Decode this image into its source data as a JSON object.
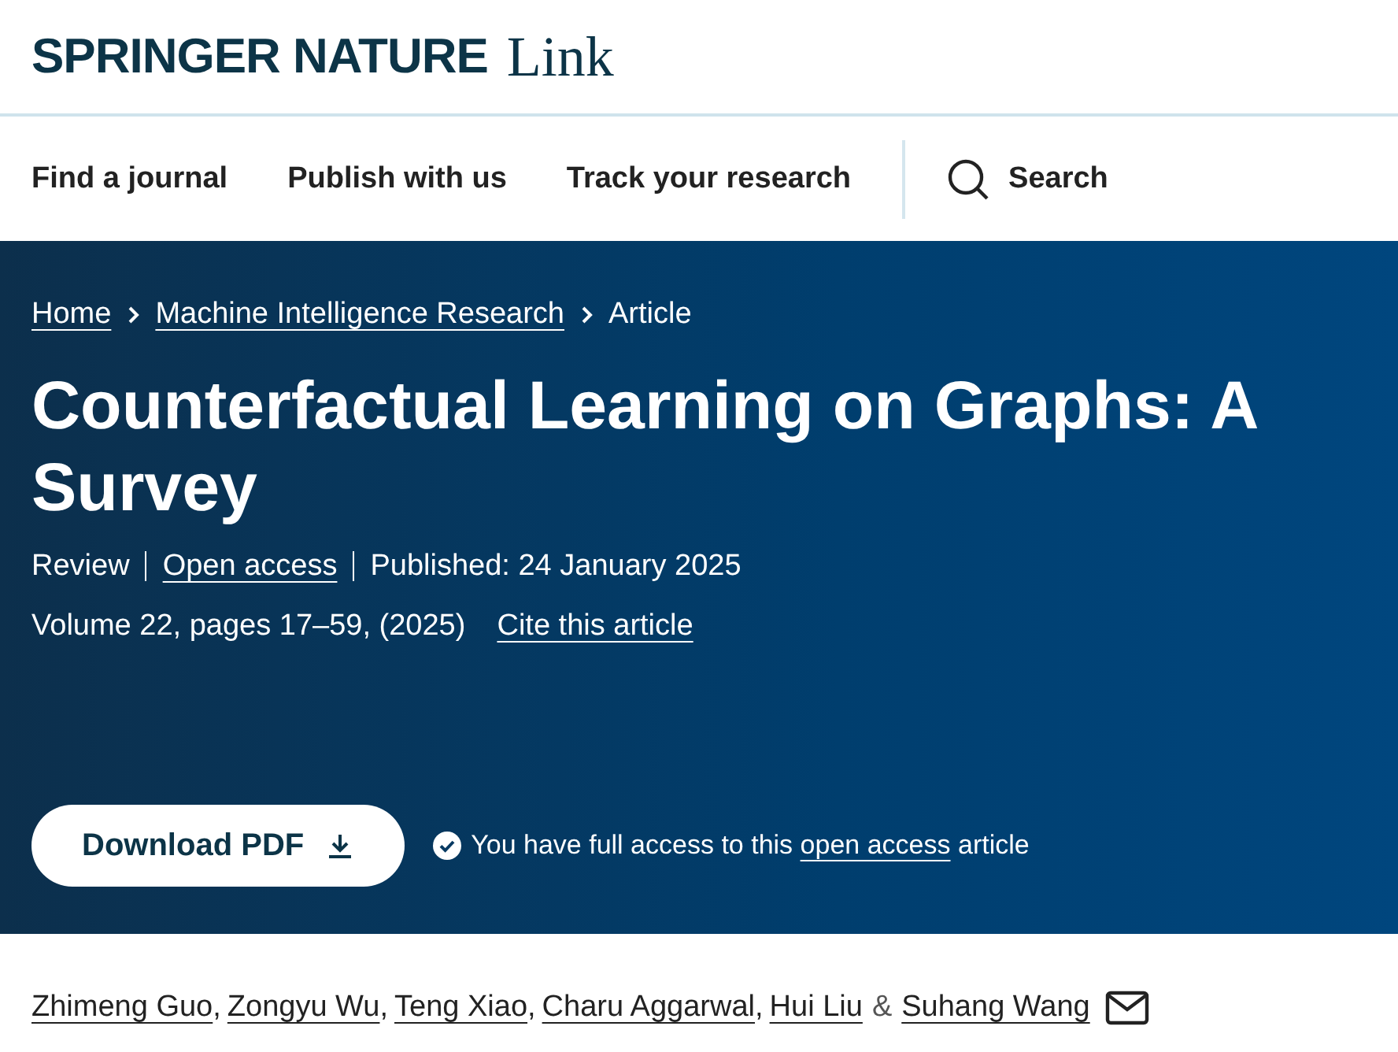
{
  "logo": {
    "brand": "SPRINGER NATURE",
    "product": "Link"
  },
  "nav": {
    "items": [
      "Find a journal",
      "Publish with us",
      "Track your research"
    ],
    "search": "Search"
  },
  "breadcrumbs": [
    {
      "label": "Home",
      "link": true
    },
    {
      "label": "Machine Intelligence Research",
      "link": true
    },
    {
      "label": "Article",
      "link": false
    }
  ],
  "title": "Counterfactual Learning on Graphs: A Survey",
  "meta": [
    {
      "label": "Review",
      "link": false
    },
    {
      "label": "Open access",
      "link": true
    },
    {
      "label": "Published: 24 January 2025",
      "link": false
    }
  ],
  "citation": {
    "text": "Volume 22, pages 17–59, (2025)",
    "cite_link": "Cite this article"
  },
  "download_button": "Download PDF",
  "access_note": {
    "before": "You have full access to this",
    "link": "open access",
    "after": "article"
  },
  "authors": [
    {
      "name": "Zhimeng Guo",
      "separator": ","
    },
    {
      "name": "Zongyu Wu",
      "separator": ","
    },
    {
      "name": "Teng Xiao",
      "separator": ","
    },
    {
      "name": "Charu Aggarwal",
      "separator": ","
    },
    {
      "name": "Hui Liu",
      "separator": "&"
    },
    {
      "name": "Suhang Wang"
    }
  ]
}
